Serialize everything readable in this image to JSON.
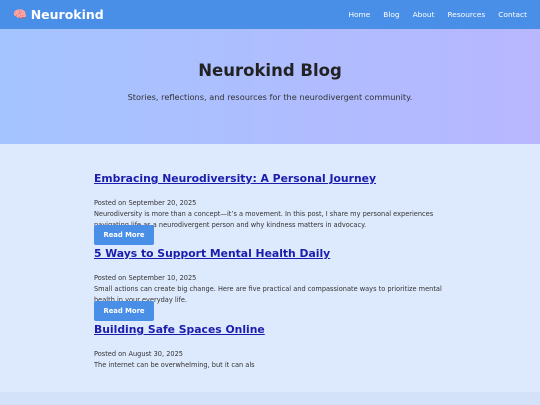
{
  "header": {
    "brand": "Neurokind",
    "brand_icon": "brain-icon",
    "nav": [
      "Home",
      "Blog",
      "About",
      "Resources",
      "Contact"
    ]
  },
  "hero": {
    "title": "Neurokind Blog",
    "subtitle": "Stories, reflections, and resources for the neurodivergent community."
  },
  "posts": [
    {
      "title": "Embracing Neurodiversity: A Personal Journey",
      "date": "Posted on September 20, 2025",
      "excerpt": "Neurodiversity is more than a concept—it’s a movement. In this post, I share my personal experiences navigating life as a neurodivergent person and why kindness matters in advocacy.",
      "button": "Read More"
    },
    {
      "title": "5 Ways to Support Mental Health Daily",
      "date": "Posted on September 10, 2025",
      "excerpt": "Small actions can create big change. Here are five practical and compassionate ways to prioritize mental health in your everyday life.",
      "button": "Read More"
    },
    {
      "title": "Building Safe Spaces Online",
      "date": "Posted on August 30, 2025",
      "excerpt": "The internet can be overwhelming, but it can als"
    }
  ],
  "colors": {
    "header_bg": "#4a8fe7",
    "button_bg": "#4a8fe7",
    "link": "#1a1dad",
    "page_bg": "#dde9fc"
  }
}
